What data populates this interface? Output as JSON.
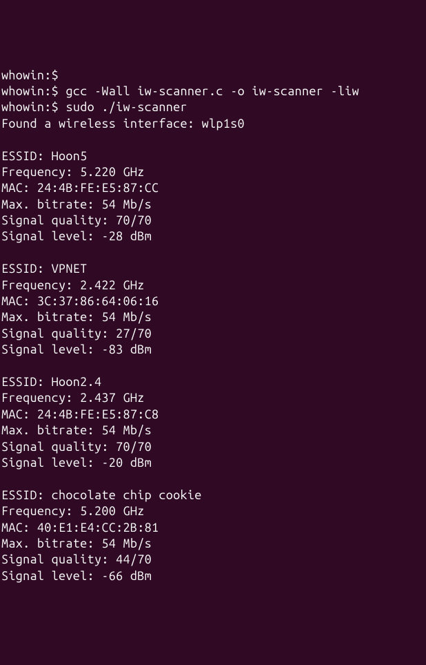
{
  "prompts": [
    {
      "user": "whowin:",
      "dollar": "$",
      "cmd": ""
    },
    {
      "user": "whowin:",
      "dollar": "$",
      "cmd": "gcc -Wall iw-scanner.c -o iw-scanner -liw"
    },
    {
      "user": "whowin:",
      "dollar": "$",
      "cmd": "sudo ./iw-scanner"
    }
  ],
  "found": "Found a wireless interface: wlp1s0",
  "networks": [
    {
      "essid": "ESSID: Hoon5",
      "freq": "Frequency: 5.220 GHz",
      "mac": "MAC: 24:4B:FE:E5:87:CC",
      "bitrate": "Max. bitrate: 54 Mb/s",
      "quality": "Signal quality: 70/70",
      "level": "Signal level: -28 dBm"
    },
    {
      "essid": "ESSID: VPNET",
      "freq": "Frequency: 2.422 GHz",
      "mac": "MAC: 3C:37:86:64:06:16",
      "bitrate": "Max. bitrate: 54 Mb/s",
      "quality": "Signal quality: 27/70",
      "level": "Signal level: -83 dBm"
    },
    {
      "essid": "ESSID: Hoon2.4",
      "freq": "Frequency: 2.437 GHz",
      "mac": "MAC: 24:4B:FE:E5:87:C8",
      "bitrate": "Max. bitrate: 54 Mb/s",
      "quality": "Signal quality: 70/70",
      "level": "Signal level: -20 dBm"
    },
    {
      "essid": "ESSID: chocolate chip cookie",
      "freq": "Frequency: 5.200 GHz",
      "mac": "MAC: 40:E1:E4:CC:2B:81",
      "bitrate": "Max. bitrate: 54 Mb/s",
      "quality": "Signal quality: 44/70",
      "level": "Signal level: -66 dBm"
    }
  ]
}
